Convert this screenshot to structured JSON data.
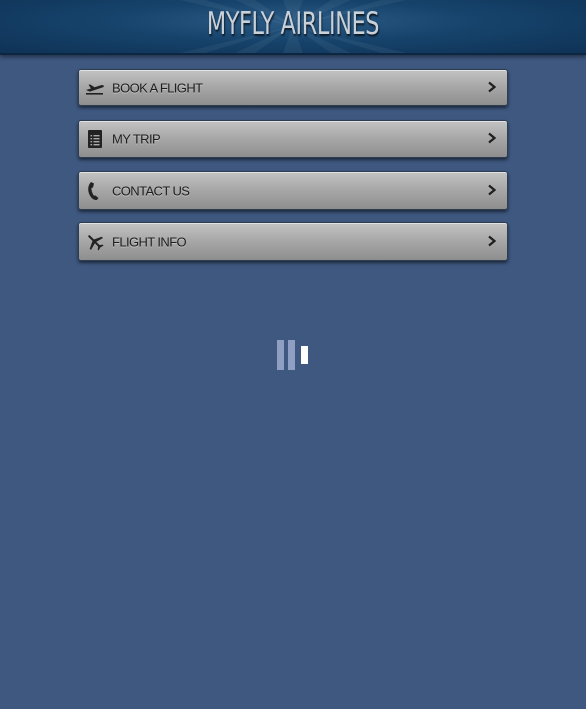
{
  "header": {
    "title": "MYFLY AIRLINES"
  },
  "menu": {
    "items": [
      {
        "label": "BOOK A FLIGHT",
        "icon": "airplane-takeoff-icon"
      },
      {
        "label": "MY TRIP",
        "icon": "document-list-icon"
      },
      {
        "label": "CONTACT US",
        "icon": "phone-icon"
      },
      {
        "label": "FLIGHT INFO",
        "icon": "airplane-icon"
      }
    ]
  },
  "loading": {
    "icon": "loading-spinner-icon"
  },
  "colors": {
    "background": "#3e5880",
    "header": "#16436b",
    "button": "#a9a9a9",
    "title_text": "#c9d0d8"
  }
}
